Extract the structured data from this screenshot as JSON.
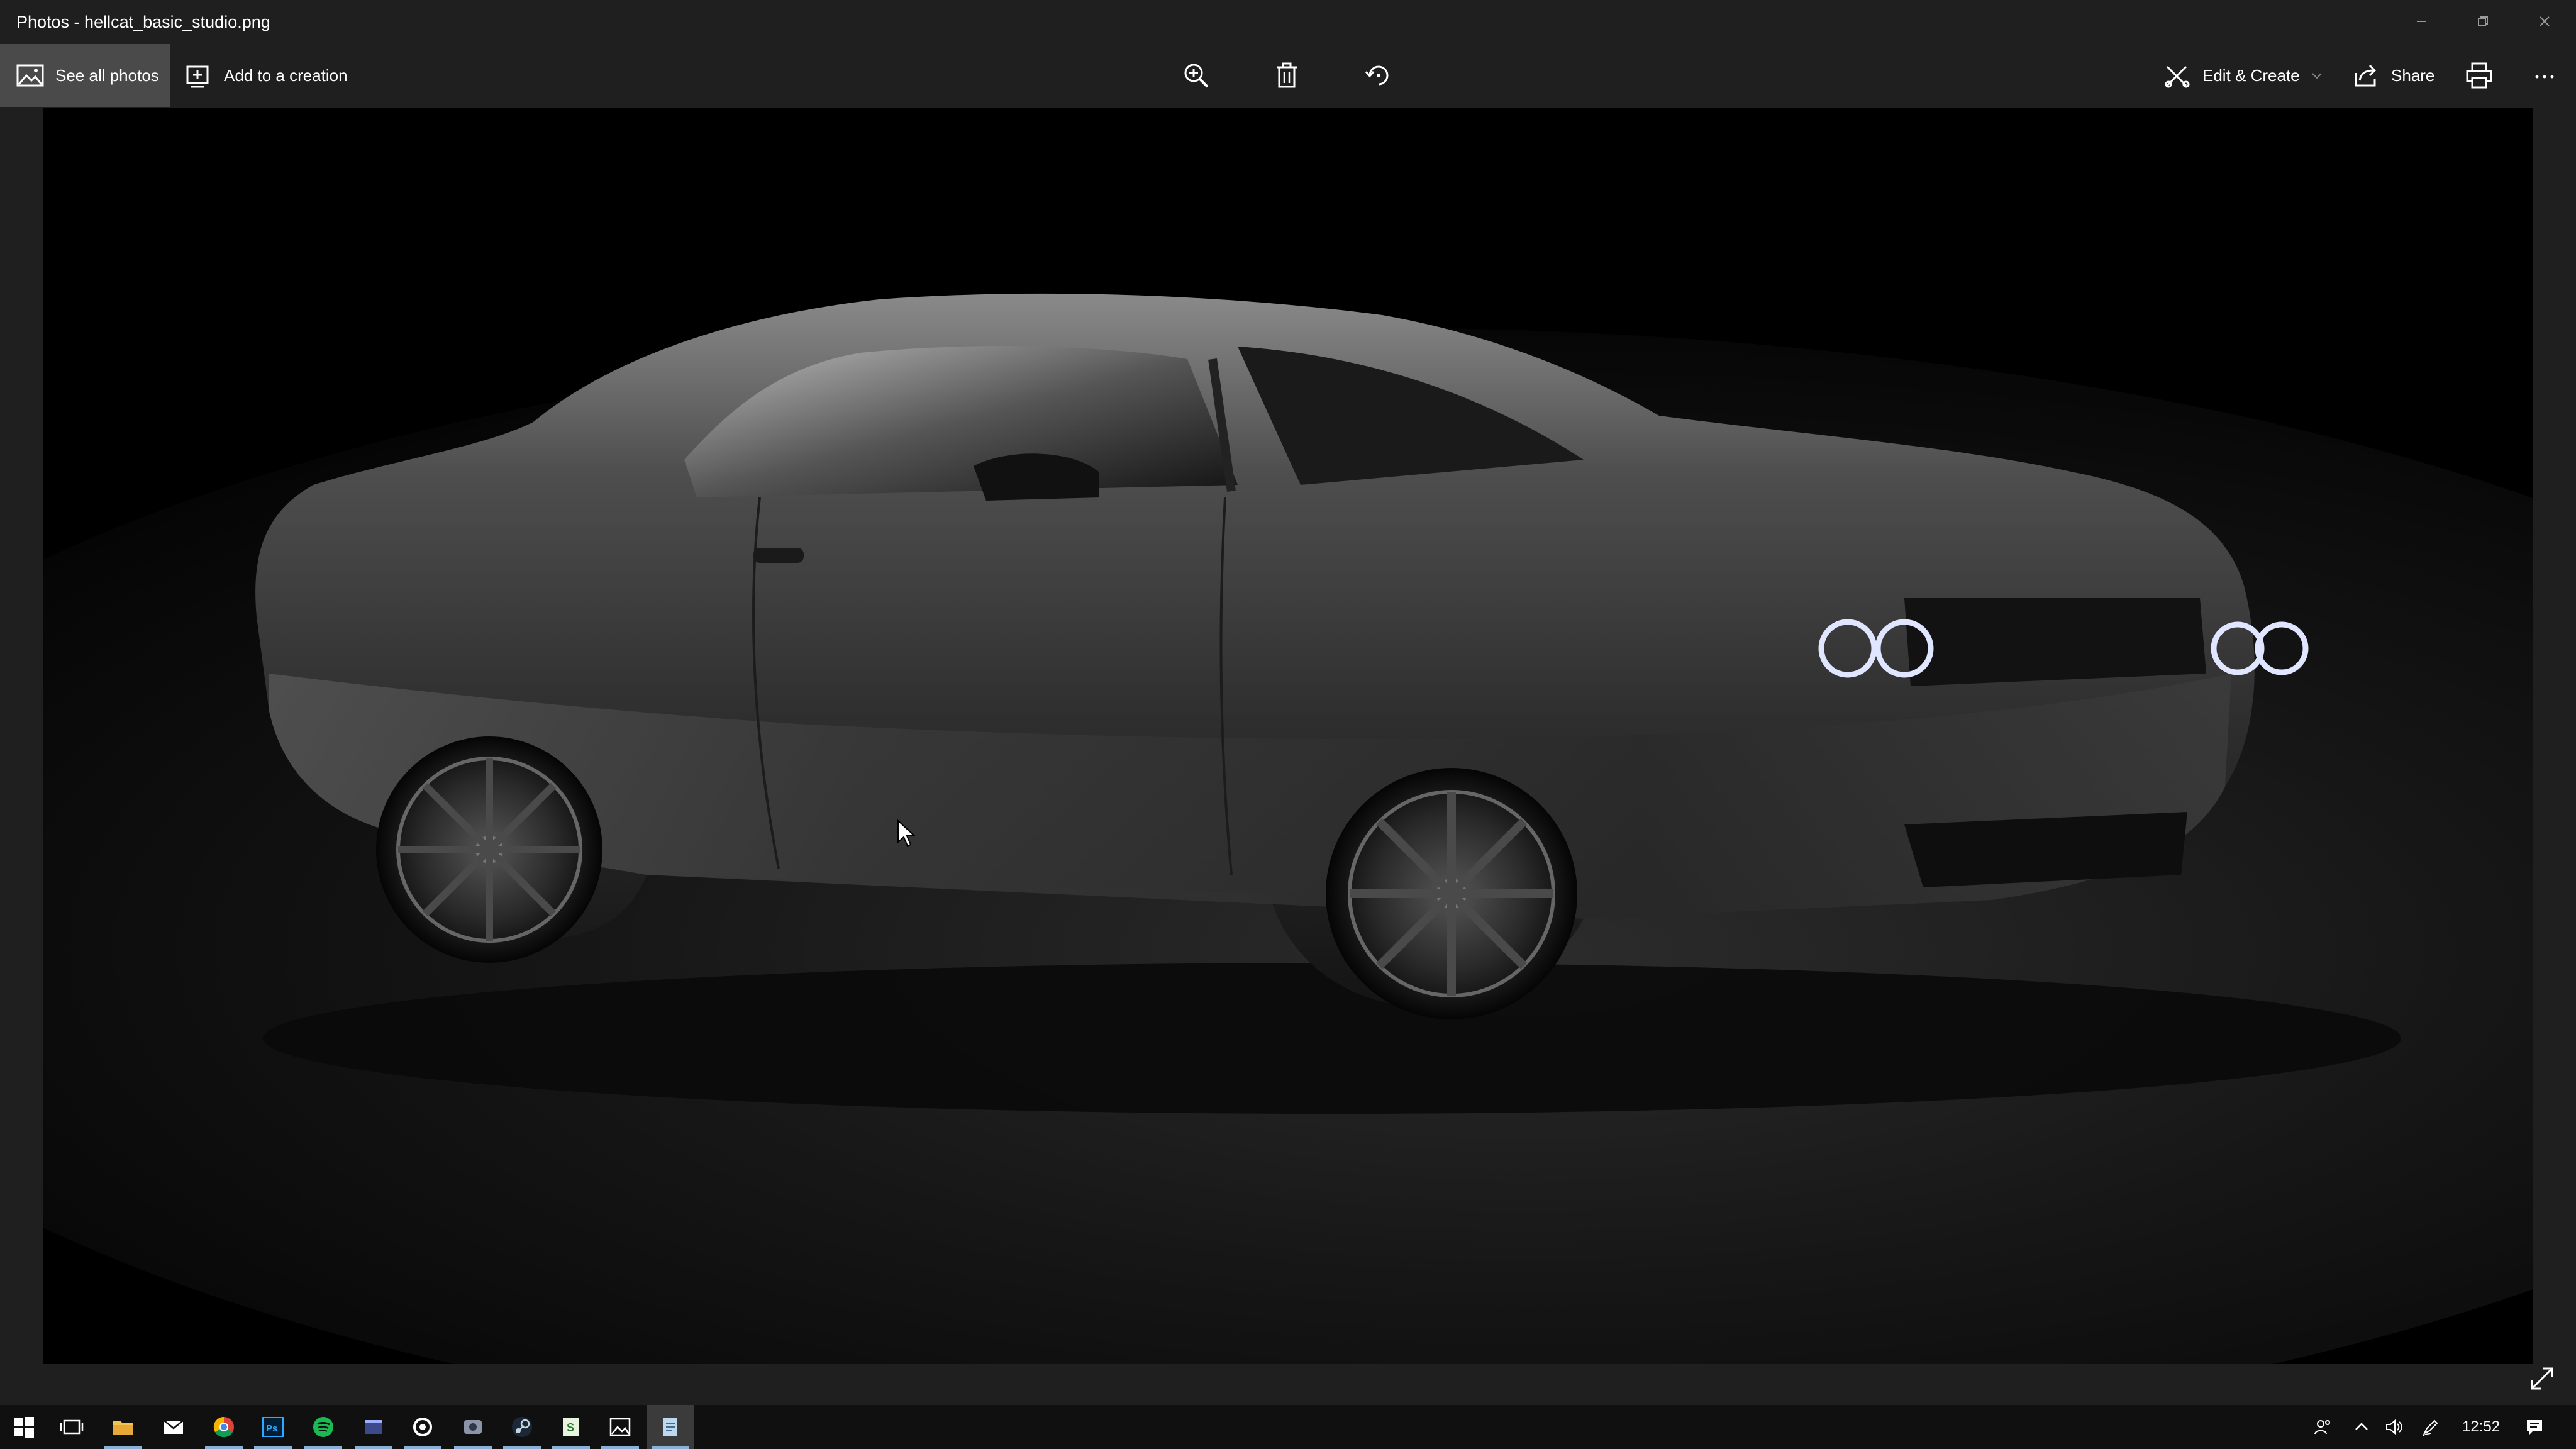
{
  "window": {
    "title": "Photos - hellcat_basic_studio.png",
    "controls": [
      "minimize-icon",
      "restore-icon",
      "close-icon"
    ]
  },
  "toolbar": {
    "see_all_photos": "See all photos",
    "add_to_creation": "Add to a creation",
    "center_icons": [
      "zoom-in-icon",
      "trash-icon",
      "rotate-icon"
    ],
    "edit_create": "Edit & Create",
    "share": "Share",
    "right_icons": [
      "print-icon",
      "more-icon"
    ]
  },
  "image": {
    "subject": "dark grey muscle car on black studio background",
    "background_color": "#000000"
  },
  "taskbar": {
    "apps": [
      "start-icon",
      "task-view-icon",
      "file-explorer-icon",
      "mail-icon",
      "chrome-icon",
      "photoshop-icon",
      "spotify-icon",
      "app-window-icon",
      "app-ring-icon",
      "app-disc-icon",
      "steam-icon",
      "app-s-icon",
      "photos-icon",
      "notepad-icon"
    ],
    "tray_icons": [
      "people-icon",
      "chevron-up-icon",
      "volume-icon",
      "pen-icon",
      "notifications-icon"
    ],
    "clock": "12:52"
  },
  "colors": {
    "chrome_bg": "#1f1f1f",
    "selected_button": "#4a4a4a",
    "taskbar_bg": "#101010",
    "spotify_green": "#1db954",
    "chrome_red": "#db4437",
    "photoshop_blue": "#31a8ff"
  }
}
